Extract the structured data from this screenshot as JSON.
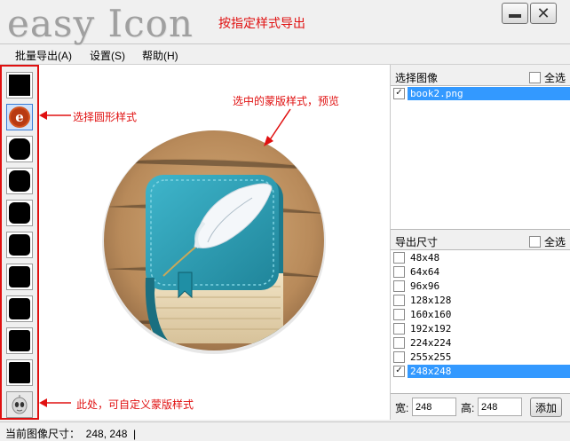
{
  "window": {
    "title": "easy Icon",
    "title_note": "按指定样式导出",
    "minimize_icon": "minimize-icon",
    "close_icon": "close-icon",
    "close_glyph": "✕"
  },
  "menu": {
    "items": [
      "批量导出(A)",
      "设置(S)",
      "帮助(H)"
    ]
  },
  "shape_styles": {
    "annotation_select": "选择圆形样式",
    "annotation_custom": "此处，可自定义蒙版样式",
    "selected_index": 1,
    "custom_icon": "alien-mask-icon"
  },
  "preview": {
    "annotation": "选中的蒙版样式，预览",
    "image_icon": "book-feather-icon"
  },
  "image_list": {
    "title": "选择图像",
    "select_all": "全选",
    "items": [
      {
        "name": "book2.png",
        "checked": true,
        "selected": true
      }
    ]
  },
  "export_sizes": {
    "title": "导出尺寸",
    "select_all": "全选",
    "items": [
      {
        "label": "48x48",
        "checked": false
      },
      {
        "label": "64x64",
        "checked": false
      },
      {
        "label": "96x96",
        "checked": false
      },
      {
        "label": "128x128",
        "checked": false
      },
      {
        "label": "160x160",
        "checked": false
      },
      {
        "label": "192x192",
        "checked": false
      },
      {
        "label": "224x224",
        "checked": false
      },
      {
        "label": "255x255",
        "checked": false
      },
      {
        "label": "248x248",
        "checked": true,
        "selected": true
      }
    ],
    "width_label": "宽:",
    "width_value": "248",
    "height_label": "高:",
    "height_value": "248",
    "add_button": "添加"
  },
  "status": {
    "text": "当前图像尺寸：  248, 248  |"
  },
  "colors": {
    "annotation_red": "#e01010",
    "selection_blue": "#3399ff",
    "book_teal": "#2a9bb0"
  }
}
